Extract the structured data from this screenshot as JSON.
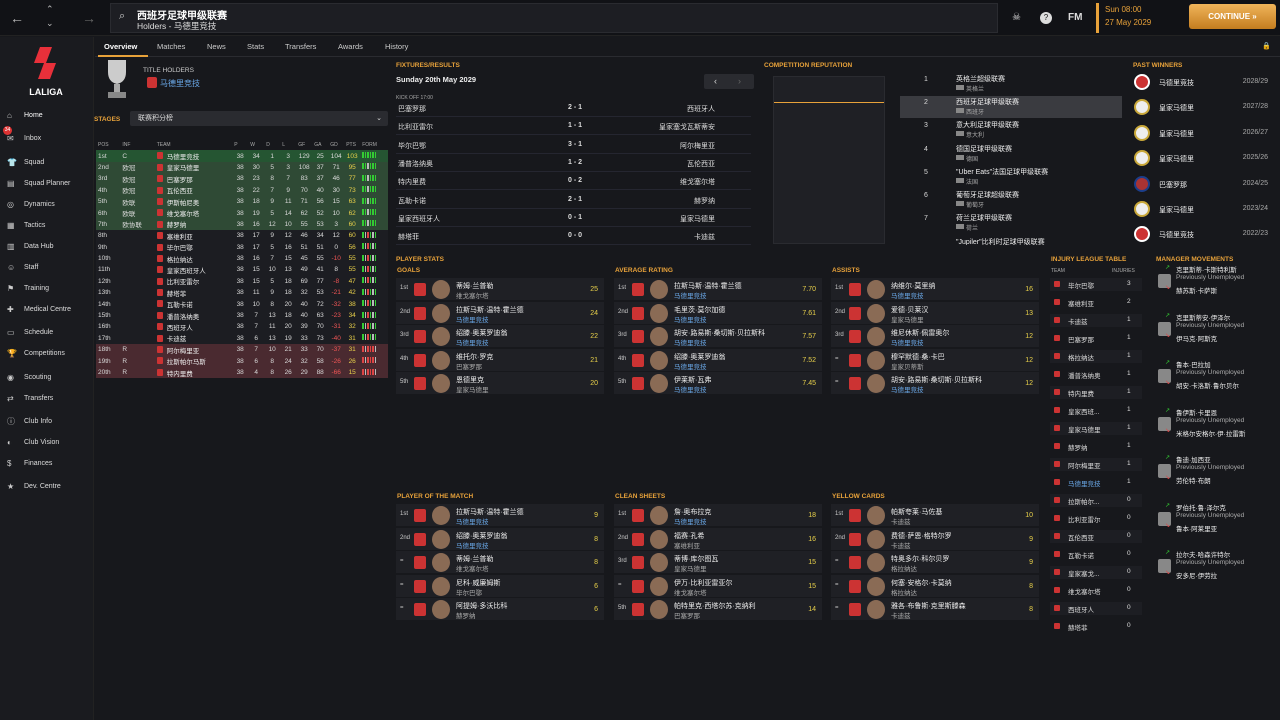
{
  "header": {
    "title": "西班牙足球甲级联赛",
    "subtitle": "Holders - 马德里竞技",
    "day": "Sun 08:00",
    "date": "27 May 2029",
    "continue": "CONTINUE »",
    "fm": "FM"
  },
  "sidebar": {
    "logo_text": "LALIGA",
    "items": [
      {
        "label": "Home",
        "icon": "home-icon"
      },
      {
        "label": "Inbox",
        "icon": "inbox-icon",
        "badge": "34"
      },
      {
        "label": "Squad",
        "icon": "shirt-icon"
      },
      {
        "label": "Squad Planner",
        "icon": "planner-icon"
      },
      {
        "label": "Dynamics",
        "icon": "dynamics-icon"
      },
      {
        "label": "Tactics",
        "icon": "tactics-icon"
      },
      {
        "label": "Data Hub",
        "icon": "data-icon"
      },
      {
        "label": "Staff",
        "icon": "staff-icon"
      },
      {
        "label": "Training",
        "icon": "training-icon"
      },
      {
        "label": "Medical Centre",
        "icon": "medical-icon"
      },
      {
        "label": "Schedule",
        "icon": "schedule-icon"
      },
      {
        "label": "Competitions",
        "icon": "trophy-icon"
      },
      {
        "label": "Scouting",
        "icon": "scouting-icon"
      },
      {
        "label": "Transfers",
        "icon": "transfers-icon"
      },
      {
        "label": "Club Info",
        "icon": "info-icon"
      },
      {
        "label": "Club Vision",
        "icon": "vision-icon"
      },
      {
        "label": "Finances",
        "icon": "finance-icon"
      },
      {
        "label": "Dev. Centre",
        "icon": "dev-icon"
      }
    ]
  },
  "tabs": [
    "Overview",
    "Matches",
    "News",
    "Stats",
    "Transfers",
    "Awards",
    "History"
  ],
  "holders": {
    "label": "TITLE HOLDERS",
    "team": "马德里竞技"
  },
  "stages": {
    "label": "STAGES",
    "select": "联赛积分榜"
  },
  "table": {
    "headers": [
      "POS",
      "INF",
      "TEAM",
      "P",
      "W",
      "D",
      "L",
      "GF",
      "GA",
      "GD",
      "PTS",
      "FORM"
    ],
    "rows": [
      [
        "1st",
        "C",
        "马德里竞技",
        "38",
        "34",
        "1",
        "3",
        "129",
        "25",
        "104",
        "103",
        "C"
      ],
      [
        "2nd",
        "欧冠",
        "皇家马德里",
        "38",
        "30",
        "5",
        "3",
        "108",
        "37",
        "71",
        "95",
        "G"
      ],
      [
        "3rd",
        "欧冠",
        "巴塞罗那",
        "38",
        "23",
        "8",
        "7",
        "83",
        "37",
        "46",
        "77",
        "G"
      ],
      [
        "4th",
        "欧冠",
        "瓦伦西亚",
        "38",
        "22",
        "7",
        "9",
        "70",
        "40",
        "30",
        "73",
        "G"
      ],
      [
        "5th",
        "欧联",
        "伊斯帕尼奥",
        "38",
        "18",
        "9",
        "11",
        "71",
        "56",
        "15",
        "63",
        "G"
      ],
      [
        "6th",
        "欧联",
        "维戈塞尔塔",
        "38",
        "19",
        "5",
        "14",
        "62",
        "52",
        "10",
        "62",
        "G"
      ],
      [
        "7th",
        "欧协联",
        "赫罗纳",
        "38",
        "16",
        "12",
        "10",
        "55",
        "53",
        "3",
        "60",
        "G"
      ],
      [
        "8th",
        "",
        "塞维利亚",
        "38",
        "17",
        "9",
        "12",
        "46",
        "34",
        "12",
        "60",
        "N"
      ],
      [
        "9th",
        "",
        "毕尔巴鄂",
        "38",
        "17",
        "5",
        "16",
        "51",
        "51",
        "0",
        "56",
        "N"
      ],
      [
        "10th",
        "",
        "格拉纳达",
        "38",
        "16",
        "7",
        "15",
        "45",
        "55",
        "-10",
        "55",
        "N"
      ],
      [
        "11th",
        "",
        "皇家西班牙人",
        "38",
        "15",
        "10",
        "13",
        "49",
        "41",
        "8",
        "55",
        "N"
      ],
      [
        "12th",
        "",
        "比利亚雷尔",
        "38",
        "15",
        "5",
        "18",
        "69",
        "77",
        "-8",
        "47",
        "N"
      ],
      [
        "13th",
        "",
        "赫塔菲",
        "38",
        "11",
        "9",
        "18",
        "32",
        "53",
        "-21",
        "42",
        "N"
      ],
      [
        "14th",
        "",
        "瓦勒卡诺",
        "38",
        "10",
        "8",
        "20",
        "40",
        "72",
        "-32",
        "38",
        "N"
      ],
      [
        "15th",
        "",
        "潘普洛纳奥",
        "38",
        "7",
        "13",
        "18",
        "40",
        "63",
        "-23",
        "34",
        "N"
      ],
      [
        "16th",
        "",
        "西班牙人",
        "38",
        "7",
        "11",
        "20",
        "39",
        "70",
        "-31",
        "32",
        "N"
      ],
      [
        "17th",
        "",
        "卡迪兹",
        "38",
        "6",
        "13",
        "19",
        "33",
        "73",
        "-40",
        "31",
        "N"
      ],
      [
        "18th",
        "R",
        "阿尔梅里亚",
        "38",
        "7",
        "10",
        "21",
        "33",
        "70",
        "-37",
        "31",
        "R"
      ],
      [
        "19th",
        "R",
        "拉斯帕尔马斯",
        "38",
        "6",
        "8",
        "24",
        "32",
        "58",
        "-26",
        "26",
        "R"
      ],
      [
        "20th",
        "R",
        "特内里费",
        "38",
        "4",
        "8",
        "26",
        "29",
        "88",
        "-66",
        "15",
        "R"
      ]
    ]
  },
  "fixtures": {
    "label": "FIXTURES/RESULTS",
    "date": "Sunday 20th May 2029",
    "kickoff": "KICK OFF 17:00",
    "rows": [
      [
        "巴塞罗那",
        "2 - 1",
        "西班牙人"
      ],
      [
        "比利亚雷尔",
        "1 - 1",
        "皇家塞戈瓦斯蒂安"
      ],
      [
        "毕尔巴鄂",
        "3 - 1",
        "阿尔梅里亚"
      ],
      [
        "潘普洛纳奥",
        "1 - 2",
        "瓦伦西亚"
      ],
      [
        "特内里费",
        "0 - 2",
        "维戈塞尔塔"
      ],
      [
        "瓦勒卡诺",
        "2 - 1",
        "赫罗纳"
      ],
      [
        "皇家西班牙人",
        "0 - 1",
        "皇家马德里"
      ],
      [
        "赫塔菲",
        "0 - 0",
        "卡迪兹"
      ]
    ]
  },
  "reputation": {
    "label": "COMPETITION REPUTATION",
    "rows": [
      [
        "1",
        "英格兰超级联赛",
        "英格兰"
      ],
      [
        "2",
        "西班牙足球甲级联赛",
        "西班牙"
      ],
      [
        "3",
        "意大利足球甲级联赛",
        "意大利"
      ],
      [
        "4",
        "德国足球甲级联赛",
        "德国"
      ],
      [
        "5",
        "\"Uber Eats\"法国足球甲级联赛",
        "法国"
      ],
      [
        "6",
        "葡萄牙足球超级联赛",
        "葡萄牙"
      ],
      [
        "7",
        "荷兰足球甲级联赛",
        "荷兰"
      ]
    ],
    "extra": "\"Jupiler\"比利时足球甲级联赛"
  },
  "past_winners": {
    "label": "PAST WINNERS",
    "rows": [
      [
        "马德里竞技",
        "2028/29"
      ],
      [
        "皇家马德里",
        "2027/28"
      ],
      [
        "皇家马德里",
        "2026/27"
      ],
      [
        "皇家马德里",
        "2025/26"
      ],
      [
        "巴塞罗那",
        "2024/25"
      ],
      [
        "皇家马德里",
        "2023/24"
      ],
      [
        "马德里竞技",
        "2022/23"
      ]
    ]
  },
  "player_stats": {
    "label": "PLAYER STATS",
    "cards": [
      {
        "label": "GOALS",
        "rows": [
          [
            "1st",
            "蒂姆·兰普勒",
            "维戈塞尔塔",
            "25",
            false
          ],
          [
            "2nd",
            "拉斯马斯·温特·霍兰德",
            "马德里竞技",
            "24",
            true
          ],
          [
            "3rd",
            "绍滕·奥莱罗迪翁",
            "马德里竞技",
            "22",
            true
          ],
          [
            "4th",
            "维托尔·罗克",
            "巴塞罗那",
            "21",
            false
          ],
          [
            "5th",
            "恩德里克",
            "皇家马德里",
            "20",
            false
          ]
        ]
      },
      {
        "label": "AVERAGE RATING",
        "rows": [
          [
            "1st",
            "拉斯马斯·温特·霍兰德",
            "马德里竞技",
            "7.70",
            true
          ],
          [
            "2nd",
            "毛里茨·莫尔加德",
            "马德里竞技",
            "7.61",
            true
          ],
          [
            "3rd",
            "胡安·路易斯·桑切斯·贝拉斯科",
            "马德里竞技",
            "7.57",
            true
          ],
          [
            "4th",
            "绍滕·奥莱罗迪翁",
            "马德里竞技",
            "7.52",
            true
          ],
          [
            "5th",
            "伊莱斯·瓦弗",
            "马德里竞技",
            "7.45",
            true
          ]
        ]
      },
      {
        "label": "ASSISTS",
        "rows": [
          [
            "1st",
            "纳维尔·莫里纳",
            "马德里竞技",
            "16",
            true
          ],
          [
            "2nd",
            "爱德·贝莱汉",
            "皇家马德里",
            "13",
            false
          ],
          [
            "3rd",
            "维尼休斯·佩雷奥尔",
            "马德里竞技",
            "12",
            true
          ],
          [
            "=",
            "穆罕默德·桑·卡巴",
            "皇家贝蒂斯",
            "12",
            false
          ],
          [
            "=",
            "胡安·路易斯·桑切斯·贝拉斯科",
            "马德里竞技",
            "12",
            true
          ]
        ]
      },
      {
        "label": "PLAYER OF THE MATCH",
        "rows": [
          [
            "1st",
            "拉斯马斯·温特·霍兰德",
            "马德里竞技",
            "9",
            true
          ],
          [
            "2nd",
            "绍滕·奥莱罗迪翁",
            "马德里竞技",
            "8",
            true
          ],
          [
            "=",
            "蒂姆·兰普勒",
            "维戈塞尔塔",
            "8",
            false
          ],
          [
            "=",
            "尼科·威廉姆斯",
            "毕尔巴鄂",
            "6",
            false
          ],
          [
            "=",
            "阿提姆·多沃比科",
            "赫罗纳",
            "6",
            false
          ]
        ]
      },
      {
        "label": "CLEAN SHEETS",
        "rows": [
          [
            "1st",
            "詹·奥布拉克",
            "马德里竞技",
            "18",
            true
          ],
          [
            "2nd",
            "福赛·孔希",
            "塞维利亚",
            "16",
            false
          ],
          [
            "3rd",
            "蒂博·库尔图瓦",
            "皇家马德里",
            "15",
            false
          ],
          [
            "=",
            "伊万·比利亚雷亚尔",
            "维戈塞尔塔",
            "15",
            false
          ],
          [
            "5th",
            "帕特里克·西塔尔苏·克纳利",
            "巴塞罗那",
            "14",
            false
          ]
        ]
      },
      {
        "label": "YELLOW CARDS",
        "rows": [
          [
            "1st",
            "帕斯夸莱·马佐基",
            "卡迪兹",
            "10",
            false
          ],
          [
            "2nd",
            "费德·萨恩·格特尔罗",
            "卡迪兹",
            "9",
            false
          ],
          [
            "=",
            "特奥多尔·科尔贝罗",
            "格拉纳达",
            "9",
            false
          ],
          [
            "=",
            "何塞·安格尔·卡莫纳",
            "格拉纳达",
            "8",
            false
          ],
          [
            "=",
            "雅各·布鲁斯·克里斯滕森",
            "卡迪兹",
            "8",
            false
          ]
        ]
      }
    ]
  },
  "injury": {
    "label": "INJURY LEAGUE TABLE",
    "team_h": "TEAM",
    "inj_h": "INJURIES",
    "rows": [
      [
        "毕尔巴鄂",
        "3"
      ],
      [
        "塞维利亚",
        "2"
      ],
      [
        "卡迪兹",
        "1"
      ],
      [
        "巴塞罗那",
        "1"
      ],
      [
        "格拉纳达",
        "1"
      ],
      [
        "潘普洛纳奥",
        "1"
      ],
      [
        "特内里费",
        "1"
      ],
      [
        "皇家西班...",
        "1"
      ],
      [
        "皇家马德里",
        "1"
      ],
      [
        "赫罗纳",
        "1"
      ],
      [
        "阿尔梅里亚",
        "1"
      ],
      [
        "马德里竞技",
        "1"
      ],
      [
        "拉斯帕尔...",
        "0"
      ],
      [
        "比利亚雷尔",
        "0"
      ],
      [
        "瓦伦西亚",
        "0"
      ],
      [
        "瓦勒卡诺",
        "0"
      ],
      [
        "皇家塞戈...",
        "0"
      ],
      [
        "维戈塞尔塔",
        "0"
      ],
      [
        "西班牙人",
        "0"
      ],
      [
        "赫塔菲",
        "0"
      ]
    ]
  },
  "movements": {
    "label": "MANAGER MOVEMENTS",
    "rows": [
      [
        "克里斯蒂·卡斯特利斯",
        "赫苏斯·卡萨斯"
      ],
      [
        "克里斯蒂安·伊泽尔",
        "伊马克·阿斯克"
      ],
      [
        "鲁本·巴拉加",
        "胡安·卡洛斯·鲁尔贝尔"
      ],
      [
        "鲁伊斯·卡里恩",
        "米格尔安格尔·伊·拉雷斯"
      ],
      [
        "鲁迪·加西亚",
        "劳伦特·布朗"
      ],
      [
        "罗伯托·鲁·泽尔克",
        "鲁本·阿莱里亚"
      ],
      [
        "拉尔夫·哈森许特尔",
        "安多尼·伊劳拉"
      ]
    ],
    "unemployed": "Previously Unemployed"
  }
}
